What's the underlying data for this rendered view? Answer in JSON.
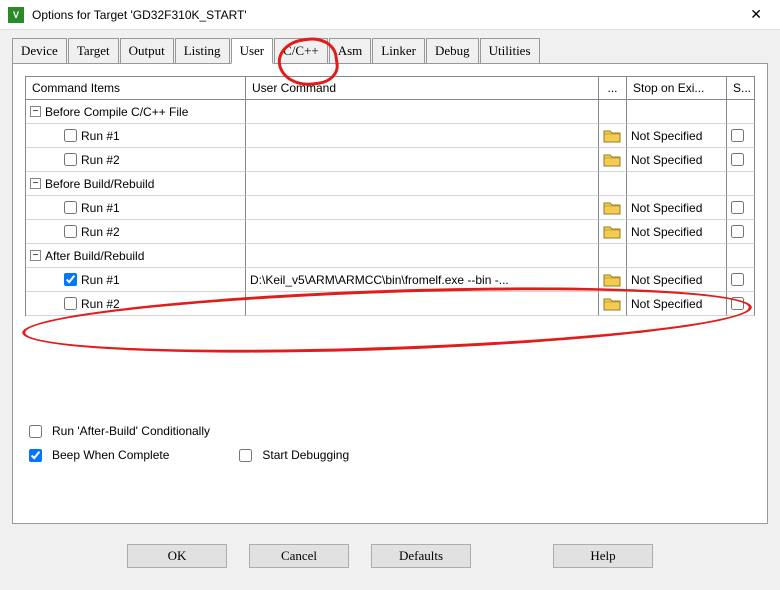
{
  "window": {
    "title": "Options for Target 'GD32F310K_START'"
  },
  "tabs": [
    "Device",
    "Target",
    "Output",
    "Listing",
    "User",
    "C/C++",
    "Asm",
    "Linker",
    "Debug",
    "Utilities"
  ],
  "activeTab": "User",
  "headers": {
    "col1": "Command Items",
    "col2": "User Command",
    "col3": "...",
    "col4": "Stop on Exi...",
    "col5": "S..."
  },
  "groups": [
    {
      "label": "Before Compile C/C++ File",
      "rows": [
        {
          "name": "Run #1",
          "checked": false,
          "cmd": "",
          "stop": "Not Specified"
        },
        {
          "name": "Run #2",
          "checked": false,
          "cmd": "",
          "stop": "Not Specified"
        }
      ]
    },
    {
      "label": "Before Build/Rebuild",
      "rows": [
        {
          "name": "Run #1",
          "checked": false,
          "cmd": "",
          "stop": "Not Specified"
        },
        {
          "name": "Run #2",
          "checked": false,
          "cmd": "",
          "stop": "Not Specified"
        }
      ]
    },
    {
      "label": "After Build/Rebuild",
      "rows": [
        {
          "name": "Run #1",
          "checked": true,
          "cmd": "D:\\Keil_v5\\ARM\\ARMCC\\bin\\fromelf.exe --bin -...",
          "stop": "Not Specified"
        },
        {
          "name": "Run #2",
          "checked": false,
          "cmd": "",
          "stop": "Not Specified"
        }
      ]
    }
  ],
  "opts": {
    "runAfterBuildCond": {
      "label": "Run 'After-Build' Conditionally",
      "checked": false
    },
    "beep": {
      "label": "Beep When Complete",
      "checked": true
    },
    "startDebug": {
      "label": "Start Debugging",
      "checked": false
    }
  },
  "buttons": {
    "ok": "OK",
    "cancel": "Cancel",
    "defaults": "Defaults",
    "help": "Help"
  }
}
